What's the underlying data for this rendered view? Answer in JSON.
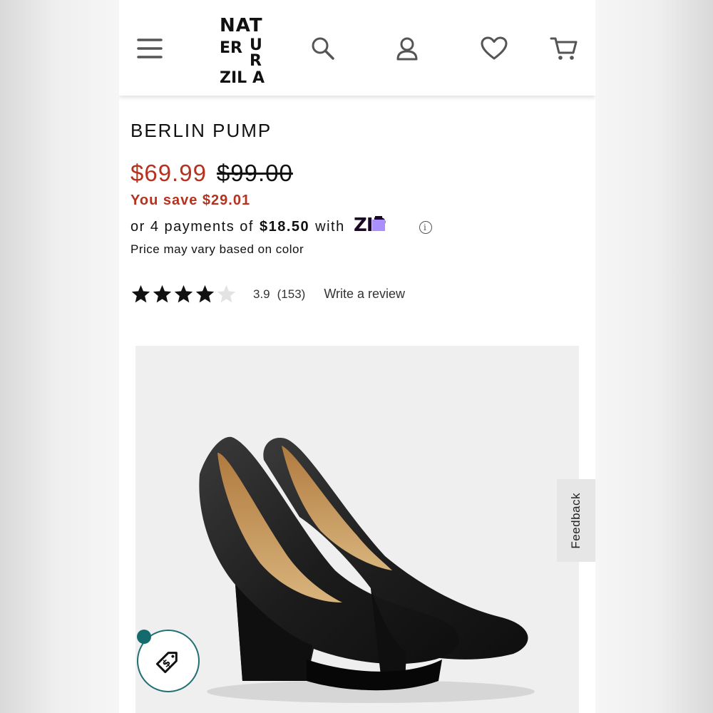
{
  "header": {
    "menu_icon": "hamburger-menu-icon",
    "logo": {
      "line1": "NAT",
      "col1": "NATURALIZER",
      "text_left": "ZIER",
      "text_right": "URALIZ"
    },
    "search_icon": "search-icon",
    "account_icon": "user-icon",
    "wishlist_icon": "heart-icon",
    "cart_icon": "cart-icon"
  },
  "product": {
    "title": "BERLIN PUMP",
    "sale_price": "$69.99",
    "original_price": "$99.00",
    "savings": "You save $29.01",
    "installment_prefix": "or 4 payments of",
    "installment_amount": "$18.50",
    "installment_suffix": "with",
    "zip_brand": "ZIP",
    "price_note": "Price may vary based on color",
    "rating_value": "3.9",
    "rating_count": "(153)",
    "rating_stars": 3.9,
    "write_review": "Write a review"
  },
  "feedback_label": "Feedback",
  "colors": {
    "sale_red": "#b5321f",
    "zip_purple": "#aa8fff",
    "zip_dark": "#1a0826",
    "badge_teal": "#146b6e"
  }
}
